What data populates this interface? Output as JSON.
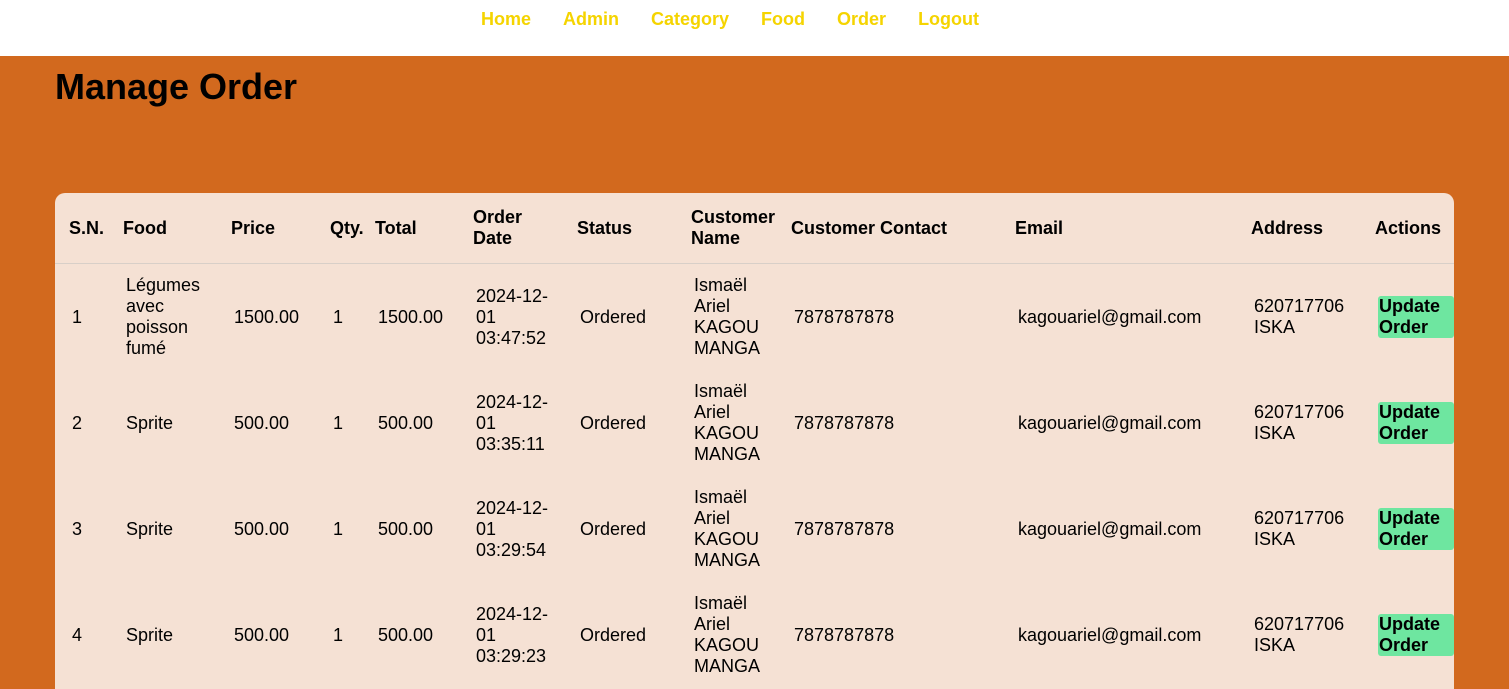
{
  "nav": {
    "home": "Home",
    "admin": "Admin",
    "category": "Category",
    "food": "Food",
    "order": "Order",
    "logout": "Logout"
  },
  "page": {
    "title": "Manage Order"
  },
  "table": {
    "headers": {
      "sn": "S.N.",
      "food": "Food",
      "price": "Price",
      "qty": "Qty.",
      "total": "Total",
      "order_date": "Order Date",
      "status": "Status",
      "customer_name": "Customer Name",
      "customer_contact": "Customer Contact",
      "email": "Email",
      "address": "Address",
      "actions": "Actions"
    },
    "rows": [
      {
        "sn": "1",
        "food": "Légumes avec poisson fumé",
        "price": "1500.00",
        "qty": "1",
        "total": "1500.00",
        "order_date": "2024-12-01 03:47:52",
        "status": "Ordered",
        "customer_name": "Ismaël Ariel KAGOU MANGA",
        "customer_contact": "7878787878",
        "email": "kagouariel@gmail.com",
        "address": "620717706 ISKA",
        "action": "Update Order"
      },
      {
        "sn": "2",
        "food": "Sprite",
        "price": "500.00",
        "qty": "1",
        "total": "500.00",
        "order_date": "2024-12-01 03:35:11",
        "status": "Ordered",
        "customer_name": "Ismaël Ariel KAGOU MANGA",
        "customer_contact": "7878787878",
        "email": "kagouariel@gmail.com",
        "address": "620717706 ISKA",
        "action": "Update Order"
      },
      {
        "sn": "3",
        "food": "Sprite",
        "price": "500.00",
        "qty": "1",
        "total": "500.00",
        "order_date": "2024-12-01 03:29:54",
        "status": "Ordered",
        "customer_name": "Ismaël Ariel KAGOU MANGA",
        "customer_contact": "7878787878",
        "email": "kagouariel@gmail.com",
        "address": "620717706 ISKA",
        "action": "Update Order"
      },
      {
        "sn": "4",
        "food": "Sprite",
        "price": "500.00",
        "qty": "1",
        "total": "500.00",
        "order_date": "2024-12-01 03:29:23",
        "status": "Ordered",
        "customer_name": "Ismaël Ariel KAGOU MANGA",
        "customer_contact": "7878787878",
        "email": "kagouariel@gmail.com",
        "address": "620717706 ISKA",
        "action": "Update Order"
      }
    ]
  },
  "colors": {
    "page_background": "#d2691e",
    "nav_link": "#f5d400",
    "table_background": "#f5e1d4",
    "update_button": "#6ee6a0"
  }
}
